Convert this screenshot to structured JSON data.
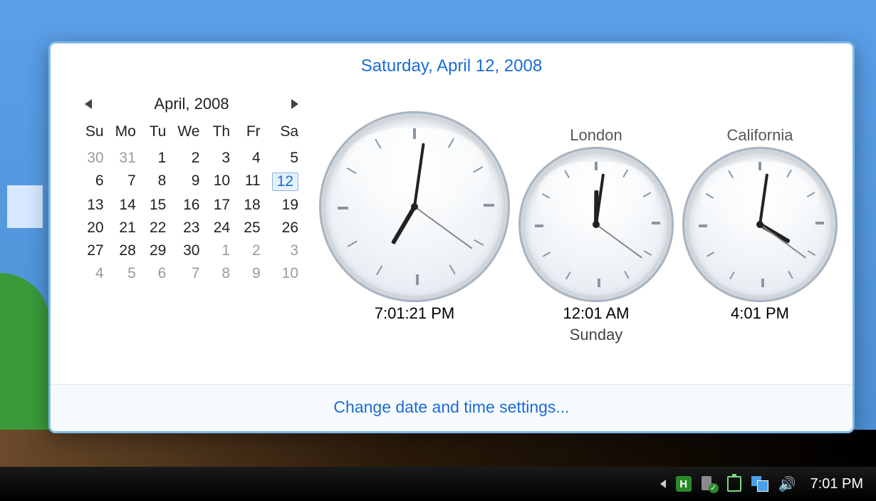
{
  "header": {
    "full_date": "Saturday, April 12, 2008"
  },
  "calendar": {
    "title": "April, 2008",
    "dow": [
      "Su",
      "Mo",
      "Tu",
      "We",
      "Th",
      "Fr",
      "Sa"
    ],
    "days": [
      {
        "n": 30,
        "other": true
      },
      {
        "n": 31,
        "other": true
      },
      {
        "n": 1
      },
      {
        "n": 2
      },
      {
        "n": 3
      },
      {
        "n": 4
      },
      {
        "n": 5
      },
      {
        "n": 6
      },
      {
        "n": 7
      },
      {
        "n": 8
      },
      {
        "n": 9
      },
      {
        "n": 10
      },
      {
        "n": 11
      },
      {
        "n": 12,
        "selected": true
      },
      {
        "n": 13
      },
      {
        "n": 14
      },
      {
        "n": 15
      },
      {
        "n": 16
      },
      {
        "n": 17
      },
      {
        "n": 18
      },
      {
        "n": 19
      },
      {
        "n": 20
      },
      {
        "n": 21
      },
      {
        "n": 22
      },
      {
        "n": 23
      },
      {
        "n": 24
      },
      {
        "n": 25
      },
      {
        "n": 26
      },
      {
        "n": 27
      },
      {
        "n": 28
      },
      {
        "n": 29
      },
      {
        "n": 30
      },
      {
        "n": 1,
        "other": true
      },
      {
        "n": 2,
        "other": true
      },
      {
        "n": 3,
        "other": true
      },
      {
        "n": 4,
        "other": true
      },
      {
        "n": 5,
        "other": true
      },
      {
        "n": 6,
        "other": true
      },
      {
        "n": 7,
        "other": true
      },
      {
        "n": 8,
        "other": true
      },
      {
        "n": 9,
        "other": true
      },
      {
        "n": 10,
        "other": true
      }
    ]
  },
  "clocks": [
    {
      "label": "",
      "time_text": "7:01:21 PM",
      "day_text": "",
      "h": 7,
      "m": 1,
      "s": 21,
      "size": "big"
    },
    {
      "label": "London",
      "time_text": "12:01 AM",
      "day_text": "Sunday",
      "h": 0,
      "m": 1,
      "s": 21,
      "size": "small"
    },
    {
      "label": "California",
      "time_text": "4:01 PM",
      "day_text": "",
      "h": 4,
      "m": 1,
      "s": 21,
      "size": "small"
    }
  ],
  "footer": {
    "link": "Change date and time settings..."
  },
  "taskbar": {
    "time": "7:01 PM"
  }
}
